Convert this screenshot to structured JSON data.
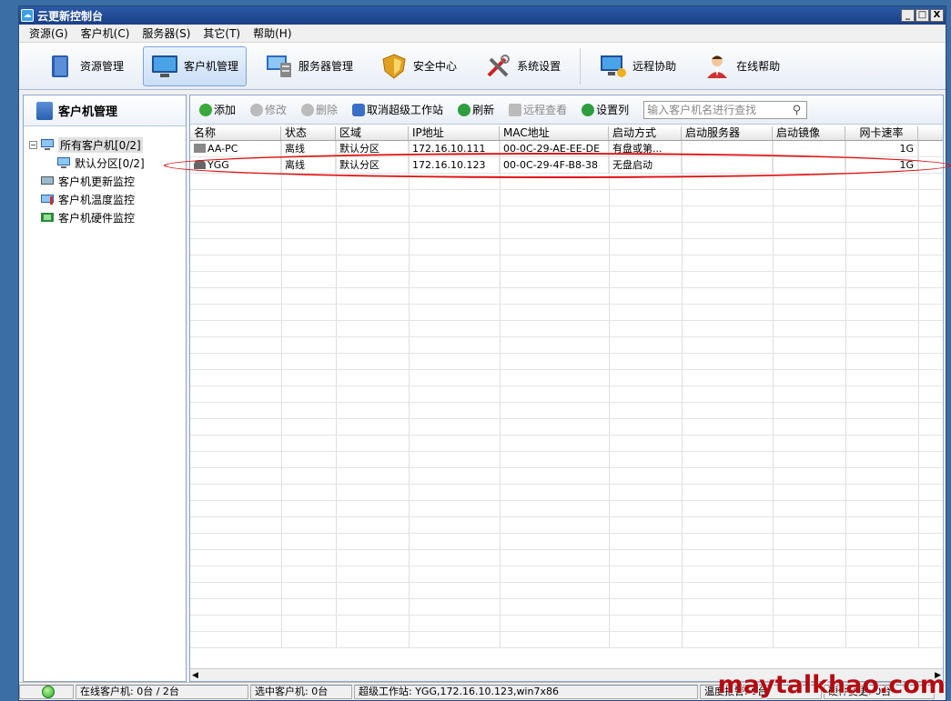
{
  "window": {
    "title": "云更新控制台",
    "buttons": [
      "_",
      "□",
      "X"
    ]
  },
  "menu": [
    "资源(G)",
    "客户机(C)",
    "服务器(S)",
    "其它(T)",
    "帮助(H)"
  ],
  "toolbar": [
    {
      "label": "资源管理",
      "icon": "book-icon"
    },
    {
      "label": "客户机管理",
      "icon": "monitor-icon",
      "active": true
    },
    {
      "label": "服务器管理",
      "icon": "server-icon"
    },
    {
      "label": "安全中心",
      "icon": "shield-icon"
    },
    {
      "label": "系统设置",
      "icon": "tools-icon"
    },
    {
      "label": "远程协助",
      "icon": "remote-icon"
    },
    {
      "label": "在线帮助",
      "icon": "person-icon"
    }
  ],
  "left": {
    "title": "客户机管理",
    "tree": [
      {
        "label": "所有客户机[0/2]",
        "level": 0,
        "selected": true
      },
      {
        "label": "默认分区[0/2]",
        "level": 1
      },
      {
        "label": "客户机更新监控",
        "level": 0
      },
      {
        "label": "客户机温度监控",
        "level": 0
      },
      {
        "label": "客户机硬件监控",
        "level": 0
      }
    ]
  },
  "subtoolbar": {
    "add": "添加",
    "edit": "修改",
    "delete": "删除",
    "cancel_super": "取消超级工作站",
    "refresh": "刷新",
    "remote_view": "远程查看",
    "set_columns": "设置列",
    "search_placeholder": "输入客户机名进行查找"
  },
  "table": {
    "columns": [
      "名称",
      "状态",
      "区域",
      "IP地址",
      "MAC地址",
      "启动方式",
      "启动服务器",
      "启动镜像",
      "网卡速率"
    ],
    "rows": [
      [
        "AA-PC",
        "离线",
        "默认分区",
        "172.16.10.111",
        "00-0C-29-AE-EE-DE",
        "有盘或第...",
        "",
        "",
        "1G"
      ],
      [
        "YGG",
        "离线",
        "默认分区",
        "172.16.10.123",
        "00-0C-29-4F-B8-38",
        "无盘启动",
        "",
        "",
        "1G"
      ]
    ]
  },
  "status": {
    "online": "在线客户机: 0台 / 2台",
    "selected": "选中客户机: 0台",
    "super": "超级工作站: YGG,172.16.10.123,win7x86",
    "temp": "温度报警: 0台",
    "hw": "硬件变更: 0台"
  },
  "watermark": "maytalkhao.com",
  "colors": {
    "titlebar": "#1a3f86",
    "highlight": "#e01010",
    "watermark": "#b50a12"
  }
}
